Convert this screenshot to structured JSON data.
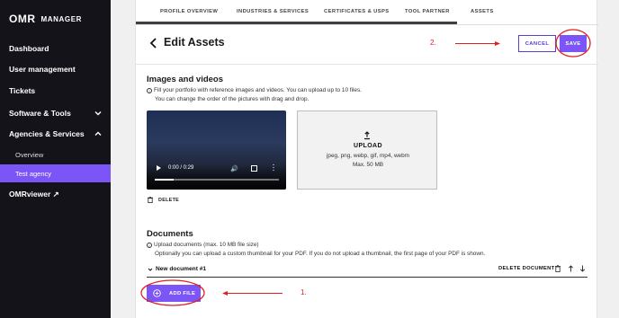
{
  "sidebar": {
    "logo_text": "OMR",
    "manager_text": "MANAGER",
    "items": [
      {
        "label": "Dashboard"
      },
      {
        "label": "User management"
      },
      {
        "label": "Tickets"
      },
      {
        "label": "Software & Tools"
      },
      {
        "label": "Agencies & Services"
      },
      {
        "label": "Overview"
      },
      {
        "label": "Test agency"
      },
      {
        "label": "OMRviewer ↗"
      }
    ]
  },
  "tabs": [
    {
      "label": "PROFILE OVERVIEW"
    },
    {
      "label": "INDUSTRIES & SERVICES"
    },
    {
      "label": "CERTIFICATES & USPS"
    },
    {
      "label": "TOOL PARTNER"
    },
    {
      "label": "ASSETS"
    }
  ],
  "header": {
    "title": "Edit Assets",
    "cancel_label": "CANCEL",
    "save_label": "SAVE"
  },
  "images": {
    "title": "Images and videos",
    "info_line1": "Fill your portfolio with reference images and videos. You can upload up to 10 files.",
    "info_line2": "You can change the order of the pictures with drag and drop.",
    "video_time": "0:00 / 0:29",
    "video_progress": 0.15,
    "delete_label": "DELETE",
    "upload_label": "UPLOAD",
    "upload_formats": "jpeg, png, webp, gif, mp4, webm",
    "upload_max": "Max. 50 MB"
  },
  "documents": {
    "title": "Documents",
    "info_line1": "Upload documents (max. 10 MB file size)",
    "info_line2": "Optionally you can upload a custom thumbnail for your PDF. If you do not upload a thumbnail, the first page of your PDF is shown.",
    "doc_name": "New document #1",
    "delete_label": "DELETE DOCUMENT",
    "add_file_label": "ADD FILE"
  },
  "annotations": {
    "step1": "1.",
    "step2": "2.",
    "color": "#e02020"
  },
  "colors": {
    "accent": "#7b55f5",
    "sidebar_bg": "#14131a"
  }
}
